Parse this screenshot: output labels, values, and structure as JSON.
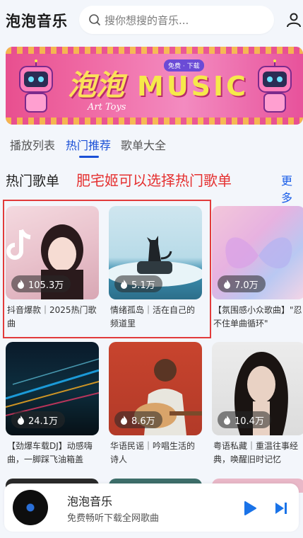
{
  "header": {
    "app_title": "泡泡音乐",
    "search_placeholder": "搜你想搜的音乐..."
  },
  "banner": {
    "word1": "泡泡",
    "word2": "MUSIC",
    "word3": "Art Toys",
    "pill": "免费 · 下载"
  },
  "tabs": [
    {
      "label": "播放列表",
      "active": false
    },
    {
      "label": "热门推荐",
      "active": true
    },
    {
      "label": "歌单大全",
      "active": false
    }
  ],
  "section": {
    "title": "热门歌单",
    "annotation": "肥宅姬可以选择热门歌单",
    "more": "更多"
  },
  "playlists": [
    {
      "plays": "105.3万",
      "desc": "抖音爆款｜2025热门歌曲"
    },
    {
      "plays": "5.1万",
      "desc": "情绪孤岛｜活在自己的频道里"
    },
    {
      "plays": "7.0万",
      "desc": "【氛围感小众歌曲】\"忍不住单曲循环\""
    },
    {
      "plays": "24.1万",
      "desc": "【劲爆车载DJ】动感嗨曲，一脚踩飞油箱盖"
    },
    {
      "plays": "8.6万",
      "desc": "华语民谣｜吟唱生活的诗人"
    },
    {
      "plays": "10.4万",
      "desc": "粤语私藏｜重温往事经典，唤醒旧时记忆"
    }
  ],
  "player": {
    "title": "泡泡音乐",
    "subtitle": "免费畅听下载全网歌曲"
  },
  "colors": {
    "accent": "#1a4fd6",
    "annotation": "#e53030",
    "highlight_border": "#e23b3b"
  }
}
